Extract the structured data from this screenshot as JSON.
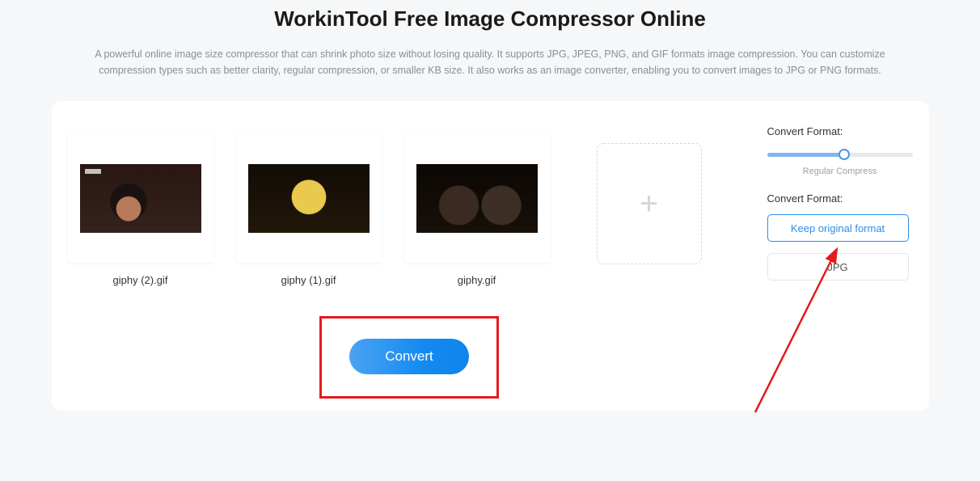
{
  "header": {
    "title": "WorkinTool Free Image Compressor Online",
    "description": "A powerful online image size compressor that can shrink photo size without losing quality. It supports JPG, JPEG, PNG, and GIF formats image compression. You can customize compression types such as better clarity, regular compression, or smaller KB size. It also works as an image converter, enabling you to convert images to JPG or PNG formats."
  },
  "files": [
    {
      "name": "giphy (2).gif"
    },
    {
      "name": "giphy (1).gif"
    },
    {
      "name": "giphy.gif"
    }
  ],
  "actions": {
    "convert_label": "Convert",
    "add_icon": "+"
  },
  "sidebar": {
    "label1": "Convert Format:",
    "slider_caption": "Regular Compress",
    "label2": "Convert Format:",
    "format_options": {
      "keep": "Keep original format",
      "jpg": "JPG"
    }
  }
}
